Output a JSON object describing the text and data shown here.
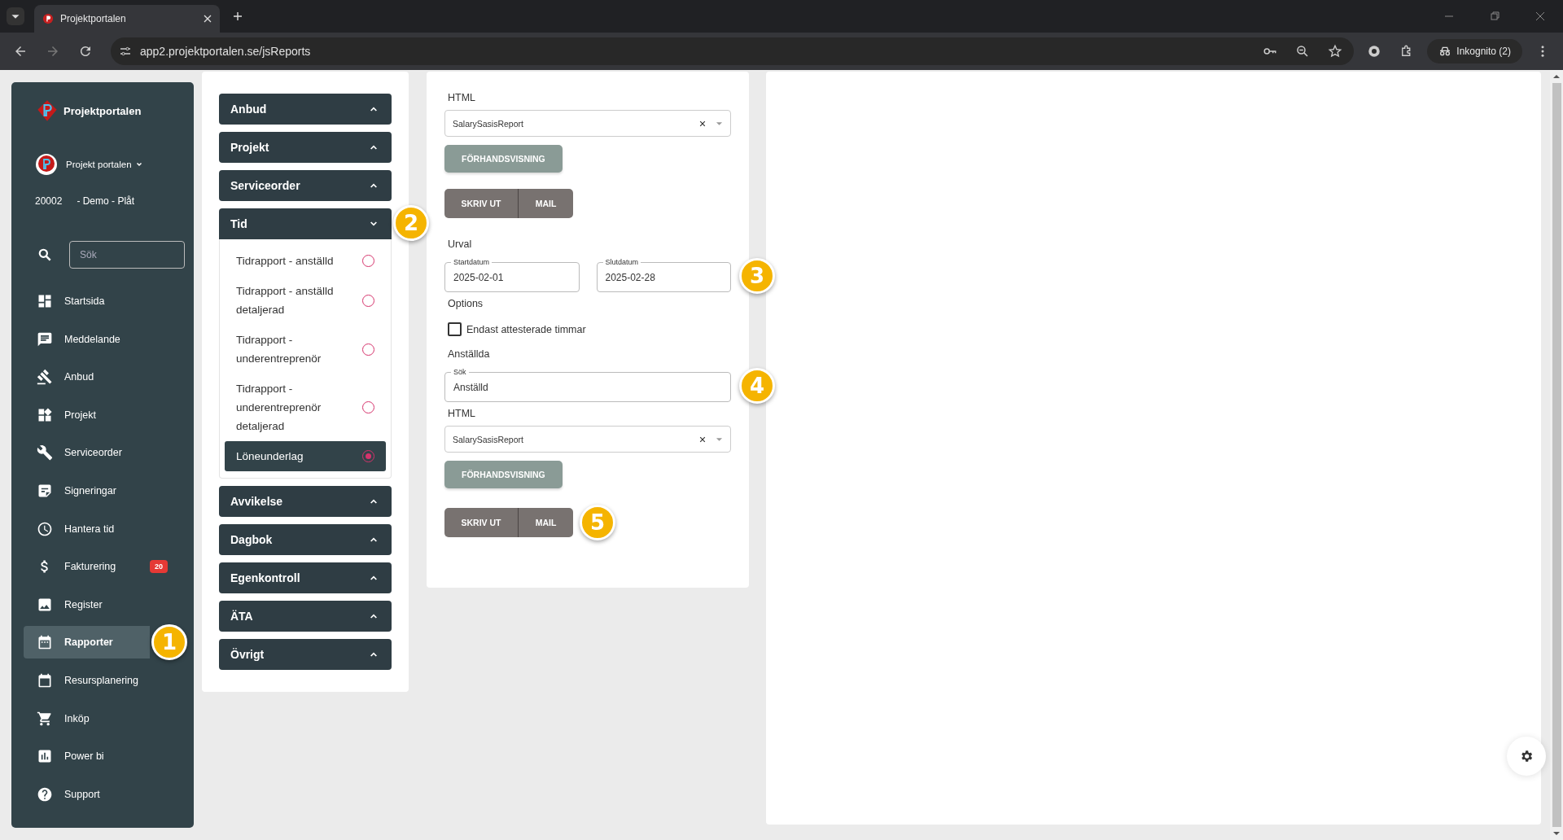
{
  "browser": {
    "tab_title": "Projektportalen",
    "url": "app2.projektportalen.se/jsReports",
    "profile": "Inkognito (2)"
  },
  "sidebar": {
    "brand": "Projektportalen",
    "account": "Projekt portalen",
    "project_number": "20002",
    "project_name": "- Demo - Plåt",
    "search": {
      "placeholder": "Sök"
    },
    "items": [
      {
        "label": "Startsida",
        "selected": false
      },
      {
        "label": "Meddelande",
        "selected": false
      },
      {
        "label": "Anbud",
        "selected": false
      },
      {
        "label": "Projekt",
        "selected": false
      },
      {
        "label": "Serviceorder",
        "selected": false
      },
      {
        "label": "Signeringar",
        "selected": false
      },
      {
        "label": "Hantera tid",
        "selected": false
      },
      {
        "label": "Fakturering",
        "selected": false,
        "badge": "20"
      },
      {
        "label": "Register",
        "selected": false
      },
      {
        "label": "Rapporter",
        "selected": true,
        "marker": "1"
      },
      {
        "label": "Resursplanering",
        "selected": false
      },
      {
        "label": "Inköp",
        "selected": false
      },
      {
        "label": "Power bi",
        "selected": false
      },
      {
        "label": "Support",
        "selected": false
      }
    ]
  },
  "report_menu": {
    "groups": [
      {
        "label": "Anbud",
        "expanded": false
      },
      {
        "label": "Projekt",
        "expanded": false
      },
      {
        "label": "Serviceorder",
        "expanded": false
      },
      {
        "label": "Tid",
        "expanded": true,
        "marker": "2",
        "reports": [
          {
            "label": "Tidrapport - anställd",
            "selected": false
          },
          {
            "label": "Tidrapport - anställd detaljerad",
            "selected": false
          },
          {
            "label": "Tidrapport - underentreprenör",
            "selected": false
          },
          {
            "label": "Tidrapport - underentreprenör detaljerad",
            "selected": false
          },
          {
            "label": "Löneunderlag",
            "selected": true
          }
        ]
      },
      {
        "label": "Avvikelse",
        "expanded": false
      },
      {
        "label": "Dagbok",
        "expanded": false
      },
      {
        "label": "Egenkontroll",
        "expanded": false
      },
      {
        "label": "ÄTA",
        "expanded": false
      },
      {
        "label": "Övrigt",
        "expanded": false
      }
    ]
  },
  "form": {
    "blocks": [
      {
        "kind": "heading",
        "text": "HTML"
      },
      {
        "kind": "select",
        "value": "SalarySasisReport"
      },
      {
        "kind": "button",
        "label": "FÖRHANDSVISNING"
      },
      {
        "kind": "button_group",
        "buttons": [
          "SKRIV UT",
          "MAIL"
        ]
      },
      {
        "kind": "heading",
        "text": "Urval"
      },
      {
        "kind": "date_range",
        "marker": "3",
        "fields": [
          {
            "label": "Startdatum",
            "value": "2025-02-01"
          },
          {
            "label": "Slutdatum",
            "value": "2025-02-28"
          }
        ]
      },
      {
        "kind": "heading",
        "text": "Options"
      },
      {
        "kind": "checkbox",
        "label": "Endast attesterade timmar",
        "checked": false
      },
      {
        "kind": "heading",
        "text": "Anställda"
      },
      {
        "kind": "search",
        "label": "Sök",
        "value": "Anställd",
        "marker": "4"
      },
      {
        "kind": "heading",
        "text": "HTML"
      },
      {
        "kind": "select",
        "value": "SalarySasisReport"
      },
      {
        "kind": "button",
        "label": "FÖRHANDSVISNING"
      },
      {
        "kind": "button_group",
        "buttons": [
          "SKRIV UT",
          "MAIL"
        ],
        "marker": "5"
      }
    ]
  }
}
